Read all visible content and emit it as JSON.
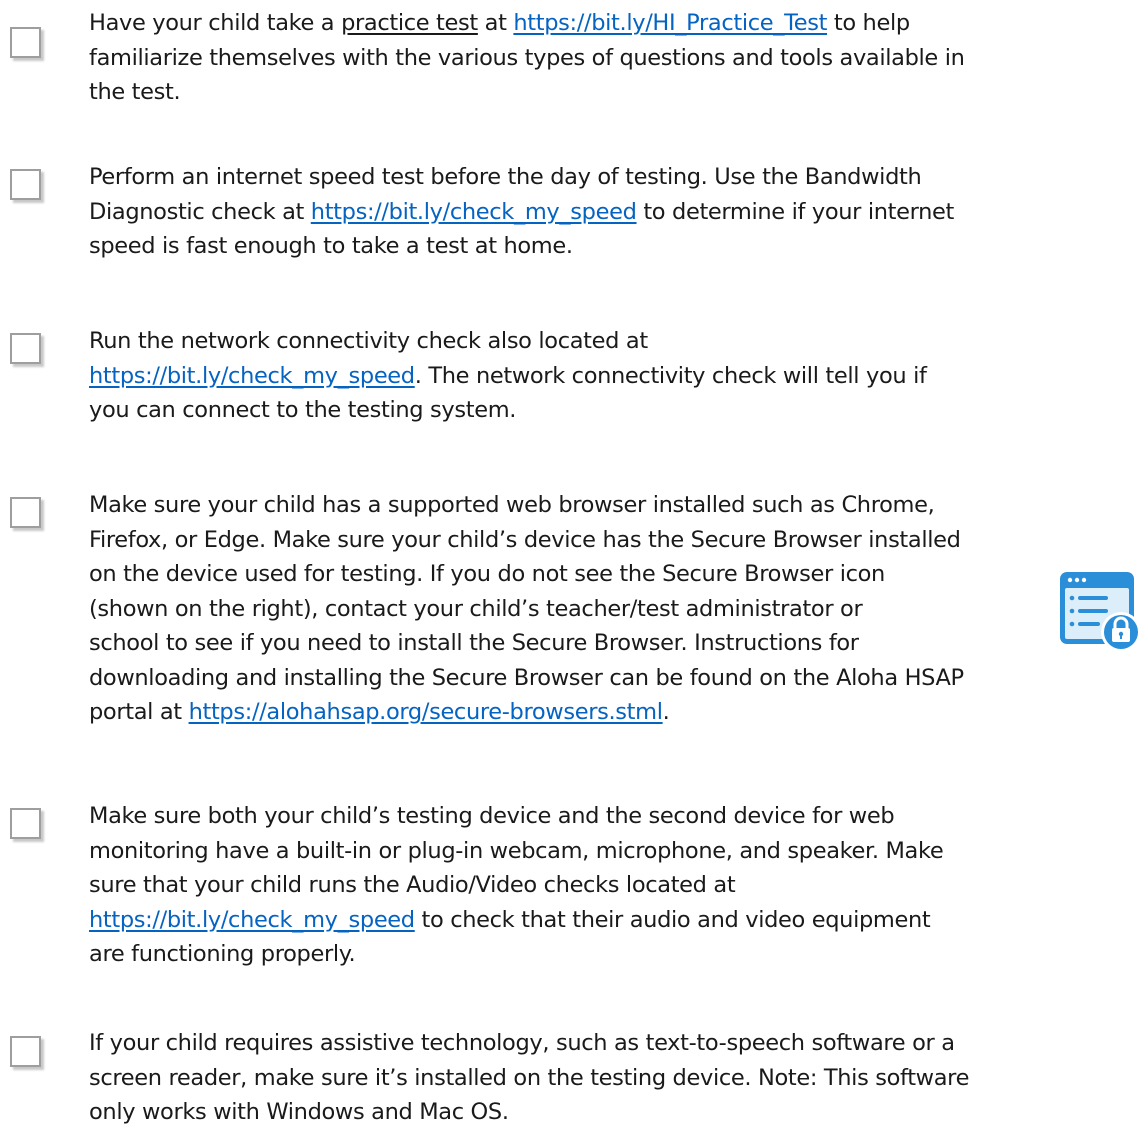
{
  "items": [
    {
      "lines": [
        [
          "Have your child take a ",
          {
            "u": "practice test"
          },
          " at ",
          {
            "link": "https://bit.ly/HI_Practice_Test"
          },
          " to help"
        ],
        [
          "familiarize themselves with the various types of questions and tools available in"
        ],
        [
          "the test."
        ]
      ]
    },
    {
      "lines": [
        [
          "Perform an internet speed test before the day of testing. Use the Bandwidth"
        ],
        [
          "Diagnostic check at ",
          {
            "link": "https://bit.ly/check_my_speed"
          },
          " to determine if your internet"
        ],
        [
          "speed is fast enough to take a test at home."
        ]
      ]
    },
    {
      "lines": [
        [
          "Run the network connectivity check also located at"
        ],
        [
          {
            "link": "https://bit.ly/check_my_speed"
          },
          ". The network connectivity check will tell you if"
        ],
        [
          "you can connect to the testing system."
        ]
      ]
    },
    {
      "lines": [
        [
          "Make sure your child has a supported web browser installed such as Chrome,"
        ],
        [
          "Firefox, or Edge. Make sure your child’s device has the Secure Browser installed"
        ],
        [
          "on the device used for testing. If you do not see the Secure Browser icon"
        ],
        [
          "(shown on the right), contact your child’s teacher/test administrator or"
        ],
        [
          "school to see if you need to install the Secure Browser. Instructions for"
        ],
        [
          "downloading and installing the Secure Browser can be found on the Aloha HSAP"
        ],
        [
          "portal at ",
          {
            "link": "https://alohahsap.org/secure-browsers.stml"
          },
          "."
        ]
      ]
    },
    {
      "lines": [
        [
          "Make sure both your child’s testing device and the second device for web"
        ],
        [
          "monitoring have a built-in or plug-in webcam, microphone, and speaker. Make"
        ],
        [
          "sure that your child runs the Audio/Video checks located at"
        ],
        [
          {
            "link": "https://bit.ly/check_my_speed"
          },
          " to check that their audio and video equipment"
        ],
        [
          "are functioning properly."
        ]
      ]
    },
    {
      "lines": [
        [
          "If your child requires assistive technology, such as text-to-speech software or a"
        ],
        [
          "screen reader, make sure it’s installed on the testing device. Note: This software"
        ],
        [
          "only works with Windows and Mac OS."
        ]
      ]
    }
  ],
  "colors": {
    "link": "#0563c1",
    "text": "#1a1a1a",
    "checkbox_border": "#9e9e9e",
    "icon_blue": "#2a8fd8"
  },
  "icons": {
    "checkbox": "empty-checkbox-icon",
    "secure_browser": "secure-browser-lock-icon"
  }
}
